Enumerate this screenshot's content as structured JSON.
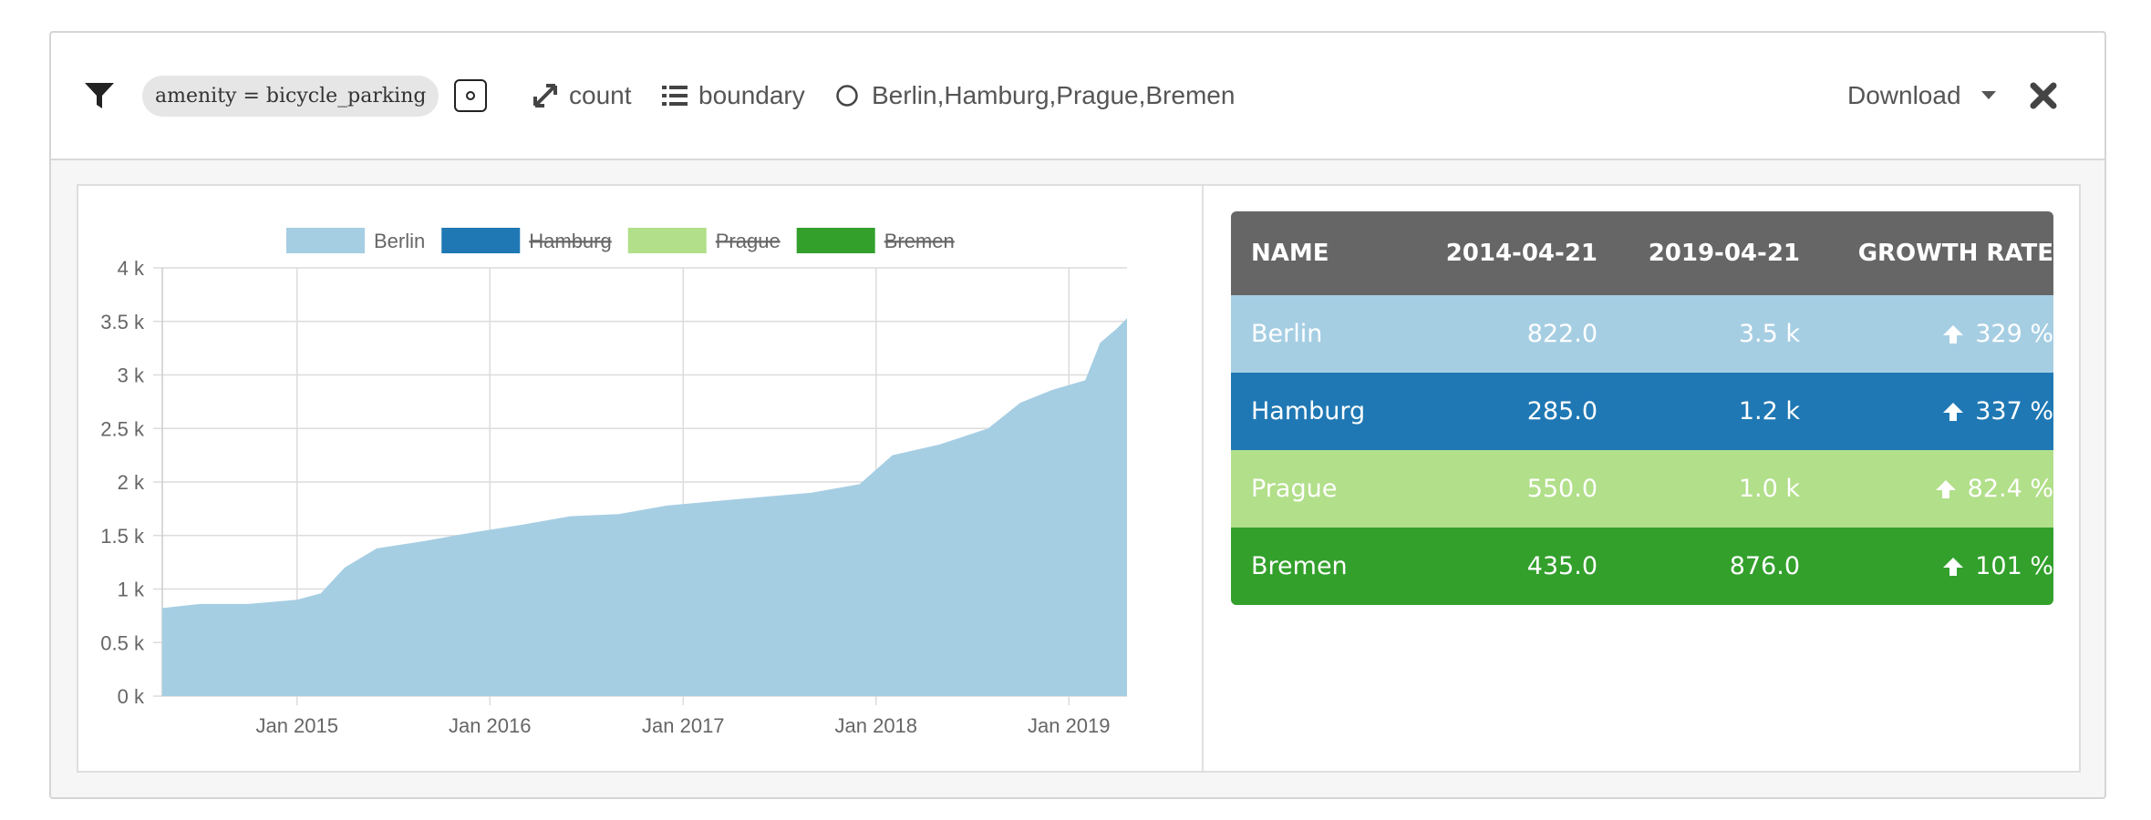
{
  "toolbar": {
    "filter_icon": "filter-icon",
    "query": "amenity = bicycle_parking",
    "measure_label": "count",
    "aggregation_label": "boundary",
    "regions_label": "Berlin,Hamburg,Prague,Bremen",
    "download_label": "Download",
    "close_icon": "close-icon"
  },
  "legend": [
    {
      "name": "Berlin",
      "color": "#a6cee3",
      "hidden": false
    },
    {
      "name": "Hamburg",
      "color": "#1f78b4",
      "hidden": true
    },
    {
      "name": "Prague",
      "color": "#b2df8a",
      "hidden": true
    },
    {
      "name": "Bremen",
      "color": "#33a02c",
      "hidden": true
    }
  ],
  "chart_data": {
    "type": "area",
    "ylim": [
      0,
      4000
    ],
    "y_ticks": [
      "0 k",
      "0.5 k",
      "1 k",
      "1.5 k",
      "2 k",
      "2.5 k",
      "3 k",
      "3.5 k",
      "4 k"
    ],
    "x_ticks": [
      "Jan 2015",
      "Jan 2016",
      "Jan 2017",
      "Jan 2018",
      "Jan 2019"
    ],
    "x_range": [
      "2014-04-21",
      "2019-04-21"
    ],
    "grid": true,
    "legend_position": "top",
    "series": [
      {
        "name": "Berlin",
        "color": "#a6cee3",
        "points": [
          [
            "2014-04-21",
            822
          ],
          [
            "2014-07-01",
            860
          ],
          [
            "2014-10-01",
            860
          ],
          [
            "2015-01-01",
            900
          ],
          [
            "2015-02-15",
            960
          ],
          [
            "2015-04-01",
            1200
          ],
          [
            "2015-06-01",
            1380
          ],
          [
            "2015-09-01",
            1450
          ],
          [
            "2015-12-01",
            1530
          ],
          [
            "2016-03-01",
            1600
          ],
          [
            "2016-06-01",
            1680
          ],
          [
            "2016-09-01",
            1700
          ],
          [
            "2016-12-01",
            1780
          ],
          [
            "2017-03-01",
            1820
          ],
          [
            "2017-06-01",
            1860
          ],
          [
            "2017-09-01",
            1900
          ],
          [
            "2017-12-01",
            1980
          ],
          [
            "2018-02-01",
            2250
          ],
          [
            "2018-05-01",
            2350
          ],
          [
            "2018-08-01",
            2500
          ],
          [
            "2018-10-01",
            2740
          ],
          [
            "2018-12-01",
            2860
          ],
          [
            "2019-02-01",
            2950
          ],
          [
            "2019-03-01",
            3300
          ],
          [
            "2019-04-01",
            3430
          ],
          [
            "2019-04-21",
            3530
          ]
        ]
      }
    ]
  },
  "table": {
    "headers": [
      "NAME",
      "2014-04-21",
      "2019-04-21",
      "GROWTH RATE"
    ],
    "rows": [
      {
        "name": "Berlin",
        "a": "822.0",
        "b": "3.5 k",
        "growth": "329 %",
        "color": "#a6cee3"
      },
      {
        "name": "Hamburg",
        "a": "285.0",
        "b": "1.2 k",
        "growth": "337 %",
        "color": "#1f78b4"
      },
      {
        "name": "Prague",
        "a": "550.0",
        "b": "1.0 k",
        "growth": "82.4 %",
        "color": "#b2df8a"
      },
      {
        "name": "Bremen",
        "a": "435.0",
        "b": "876.0",
        "growth": "101 %",
        "color": "#33a02c"
      }
    ]
  }
}
